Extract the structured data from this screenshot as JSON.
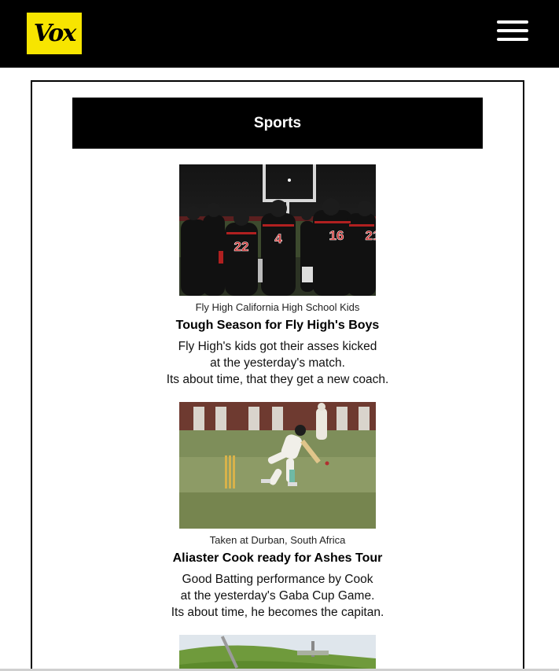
{
  "header": {
    "logo_text": "Vox",
    "logo_color": "#f7e500",
    "menu_icon": "hamburger-icon"
  },
  "section": {
    "title": "Sports"
  },
  "articles": [
    {
      "caption": "Fly High California High School Kids",
      "headline": "Tough Season for Fly High's Boys",
      "summary_lines": [
        "Fly High's kids got their asses kicked",
        "at the yesterday's match.",
        "Its about time, that they get a new coach."
      ],
      "jersey_numbers": [
        "22",
        "4",
        "16",
        "21"
      ]
    },
    {
      "caption": "Taken at Durban, South Africa",
      "headline": "Aliaster Cook ready for Ashes Tour",
      "summary_lines": [
        "Good Batting performance by Cook",
        "at the yesterday's Gaba Cup Game.",
        "Its about time, he becomes the capitan."
      ]
    }
  ]
}
